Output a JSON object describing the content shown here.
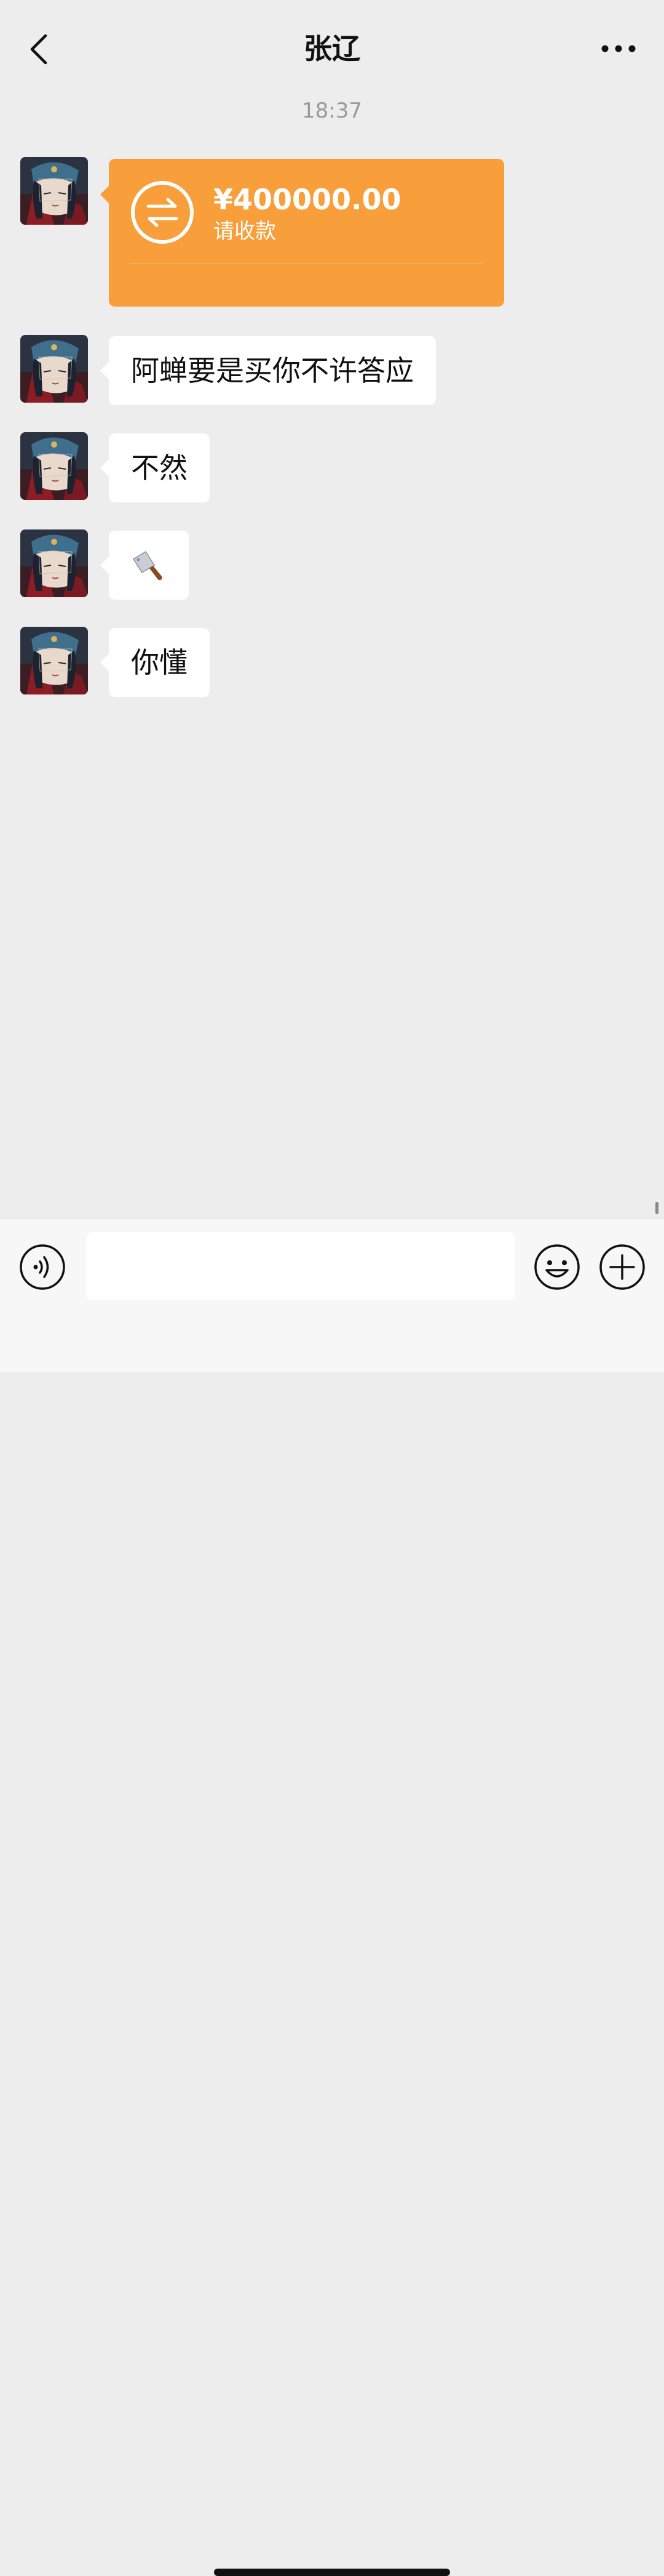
{
  "header": {
    "title": "张辽",
    "back_icon": "chevron-left-icon",
    "more_icon": "more-dots-icon"
  },
  "chat": {
    "timestamp": "18:37",
    "transfer": {
      "amount": "¥400000.00",
      "status": "请收款",
      "icon": "transfer-arrows-icon",
      "color": "#F89E3A"
    },
    "messages": [
      {
        "text": "阿蝉要是买你不许答应"
      },
      {
        "text": "不然"
      },
      {
        "text": "",
        "icon": "cleaver-knife-icon"
      },
      {
        "text": "你懂"
      }
    ]
  },
  "input_bar": {
    "voice_icon": "voice-icon",
    "emoji_icon": "emoji-icon",
    "plus_icon": "plus-icon",
    "placeholder": ""
  },
  "colors": {
    "background": "#EDEDED",
    "bubble": "#FFFFFF",
    "transfer": "#F89E3A"
  }
}
